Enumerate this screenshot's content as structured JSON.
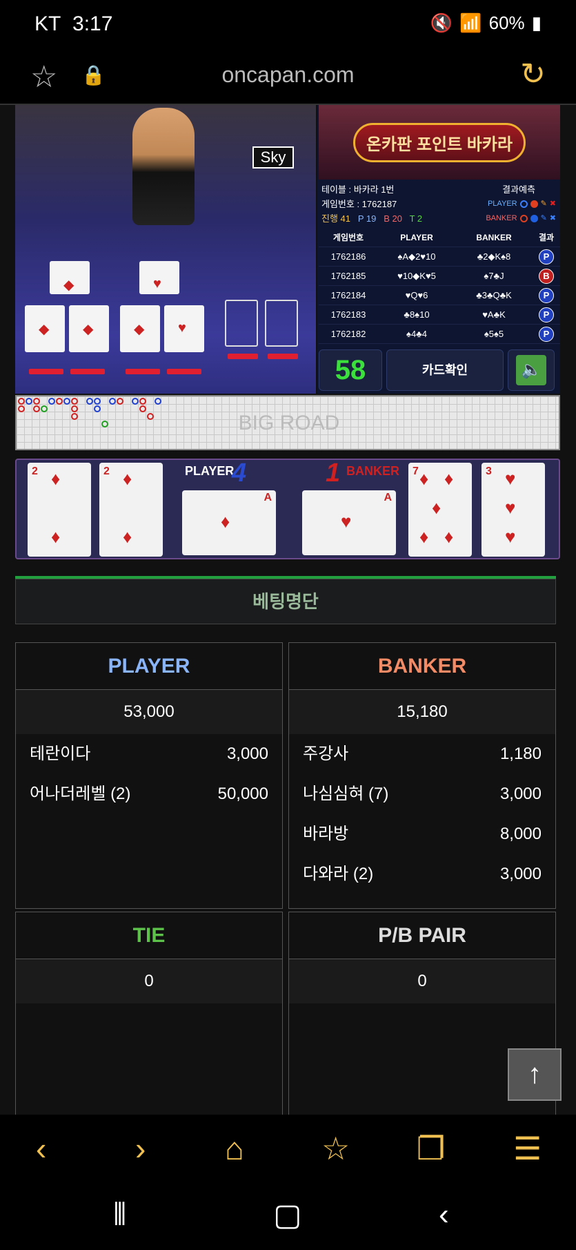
{
  "status_bar": {
    "carrier": "KT",
    "time": "3:17",
    "battery": "60%"
  },
  "browser": {
    "url": "oncapan.com"
  },
  "game": {
    "video_label": "PLAYER | BANKER",
    "video_sign": "Sky",
    "banner": "온카판 포인트 바카라",
    "table": "테이블 : 바카라 1번",
    "prediction_label": "결과예측",
    "game_no": "게임번호 : 1762187",
    "progress": "진행 41",
    "p_count": "P 19",
    "b_count": "B 20",
    "t_count": "T 2",
    "pred_player": "PLAYER",
    "pred_banker": "BANKER",
    "history_headers": [
      "게임번호",
      "PLAYER",
      "BANKER",
      "결과"
    ],
    "history": [
      {
        "no": "1762186",
        "player": "♠A◆2♥10",
        "banker": "♣2◆K♠8",
        "result": "P"
      },
      {
        "no": "1762185",
        "player": "♥10◆K♥5",
        "banker": "♠7♣J",
        "result": "B"
      },
      {
        "no": "1762184",
        "player": "♥Q♥6",
        "banker": "♣3♣Q♣K",
        "result": "P"
      },
      {
        "no": "1762183",
        "player": "♣8♠10",
        "banker": "♥A♣K",
        "result": "P"
      },
      {
        "no": "1762182",
        "player": "♠4♣4",
        "banker": "♠5♠5",
        "result": "P"
      }
    ],
    "timer": "58",
    "card_check": "카드확인",
    "bigroad_title": "BIG ROAD",
    "player_label": "PLAYER",
    "player_score": "4",
    "banker_label": "BANKER",
    "banker_score": "1",
    "player_cards": [
      {
        "rank": "2",
        "suit": "♦"
      },
      {
        "rank": "2",
        "suit": "♦"
      },
      {
        "rank": "A",
        "suit": "♦"
      }
    ],
    "banker_cards": [
      {
        "rank": "A",
        "suit": "♥"
      },
      {
        "rank": "7",
        "suit": "♦"
      },
      {
        "rank": "3",
        "suit": "♥"
      }
    ]
  },
  "betting": {
    "title": "베팅명단",
    "player": {
      "label": "PLAYER",
      "total": "53,000",
      "entries": [
        {
          "name": "테란이다",
          "amount": "3,000"
        },
        {
          "name": "어나더레벨 (2)",
          "amount": "50,000"
        }
      ]
    },
    "banker": {
      "label": "BANKER",
      "total": "15,180",
      "entries": [
        {
          "name": "주강사",
          "amount": "1,180"
        },
        {
          "name": "나심심혀 (7)",
          "amount": "3,000"
        },
        {
          "name": "바라방",
          "amount": "8,000"
        },
        {
          "name": "다와라 (2)",
          "amount": "3,000"
        }
      ]
    },
    "tie": {
      "label": "TIE",
      "total": "0"
    },
    "pair": {
      "label": "P/B PAIR",
      "total": "0"
    }
  },
  "colors": {
    "player": "#8ab4f8",
    "banker": "#f28b66",
    "tie": "#5cc24a",
    "pair": "#dddddd",
    "accent": "#f0c050"
  }
}
